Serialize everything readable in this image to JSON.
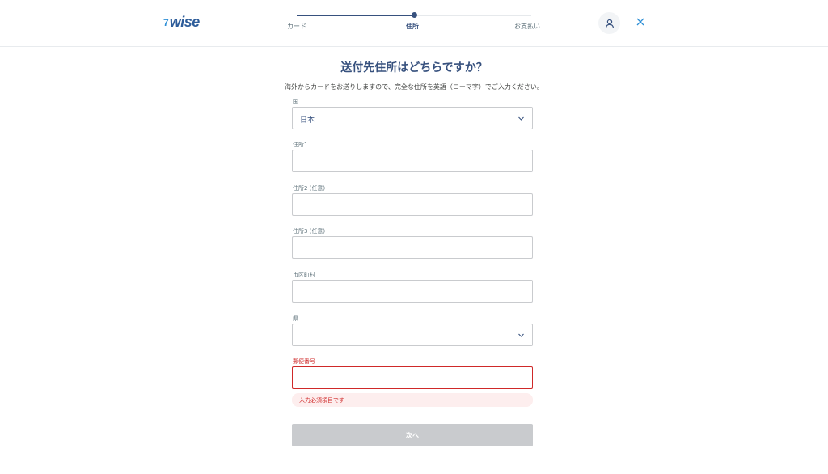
{
  "header": {
    "logo_text": "wise",
    "logo_mark": "7",
    "steps": [
      {
        "label": "カード"
      },
      {
        "label": "住所"
      },
      {
        "label": "お支払い"
      }
    ],
    "progress": 0.5,
    "profile_icon": "user-icon",
    "close_icon": "close-icon"
  },
  "page": {
    "title": "送付先住所はどちらですか？",
    "subtitle": "海外からカードをお送りしますので、完全な住所を英語（ローマ字）でご入力ください。"
  },
  "form": {
    "country": {
      "label": "国",
      "value": "日本"
    },
    "address1": {
      "label": "住所1",
      "value": ""
    },
    "address2": {
      "label": "住所2 (任意)",
      "value": ""
    },
    "address3": {
      "label": "住所3 (任意)",
      "value": ""
    },
    "city": {
      "label": "市区町村",
      "value": ""
    },
    "prefecture": {
      "label": "県",
      "value": ""
    },
    "postal": {
      "label": "郵便番号",
      "value": "",
      "error": "入力必須項目です"
    },
    "submit_label": "次へ"
  },
  "colors": {
    "primary": "#37517e",
    "error": "#cf2929",
    "disabled_button": "#c9cbce"
  }
}
